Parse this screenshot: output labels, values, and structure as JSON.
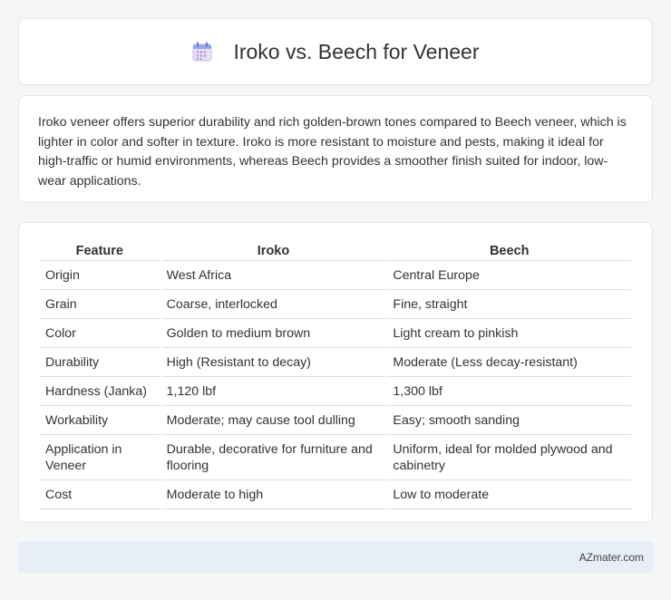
{
  "header": {
    "title": "Iroko vs. Beech for Veneer",
    "icon": "calendar-icon"
  },
  "summary": {
    "text": "Iroko veneer offers superior durability and rich golden-brown tones compared to Beech veneer, which is lighter in color and softer in texture. Iroko is more resistant to moisture and pests, making it ideal for high-traffic or humid environments, whereas Beech provides a smoother finish suited for indoor, low-wear applications."
  },
  "table": {
    "headers": [
      "Feature",
      "Iroko",
      "Beech"
    ],
    "rows": [
      [
        "Origin",
        "West Africa",
        "Central Europe"
      ],
      [
        "Grain",
        "Coarse, interlocked",
        "Fine, straight"
      ],
      [
        "Color",
        "Golden to medium brown",
        "Light cream to pinkish"
      ],
      [
        "Durability",
        "High (Resistant to decay)",
        "Moderate (Less decay-resistant)"
      ],
      [
        "Hardness (Janka)",
        "1,120 lbf",
        "1,300 lbf"
      ],
      [
        "Workability",
        "Moderate; may cause tool dulling",
        "Easy; smooth sanding"
      ],
      [
        "Application in Veneer",
        "Durable, decorative for furniture and flooring",
        "Uniform, ideal for molded plywood and cabinetry"
      ],
      [
        "Cost",
        "Moderate to high",
        "Low to moderate"
      ]
    ]
  },
  "footer": {
    "brand": "AZmater.com"
  }
}
